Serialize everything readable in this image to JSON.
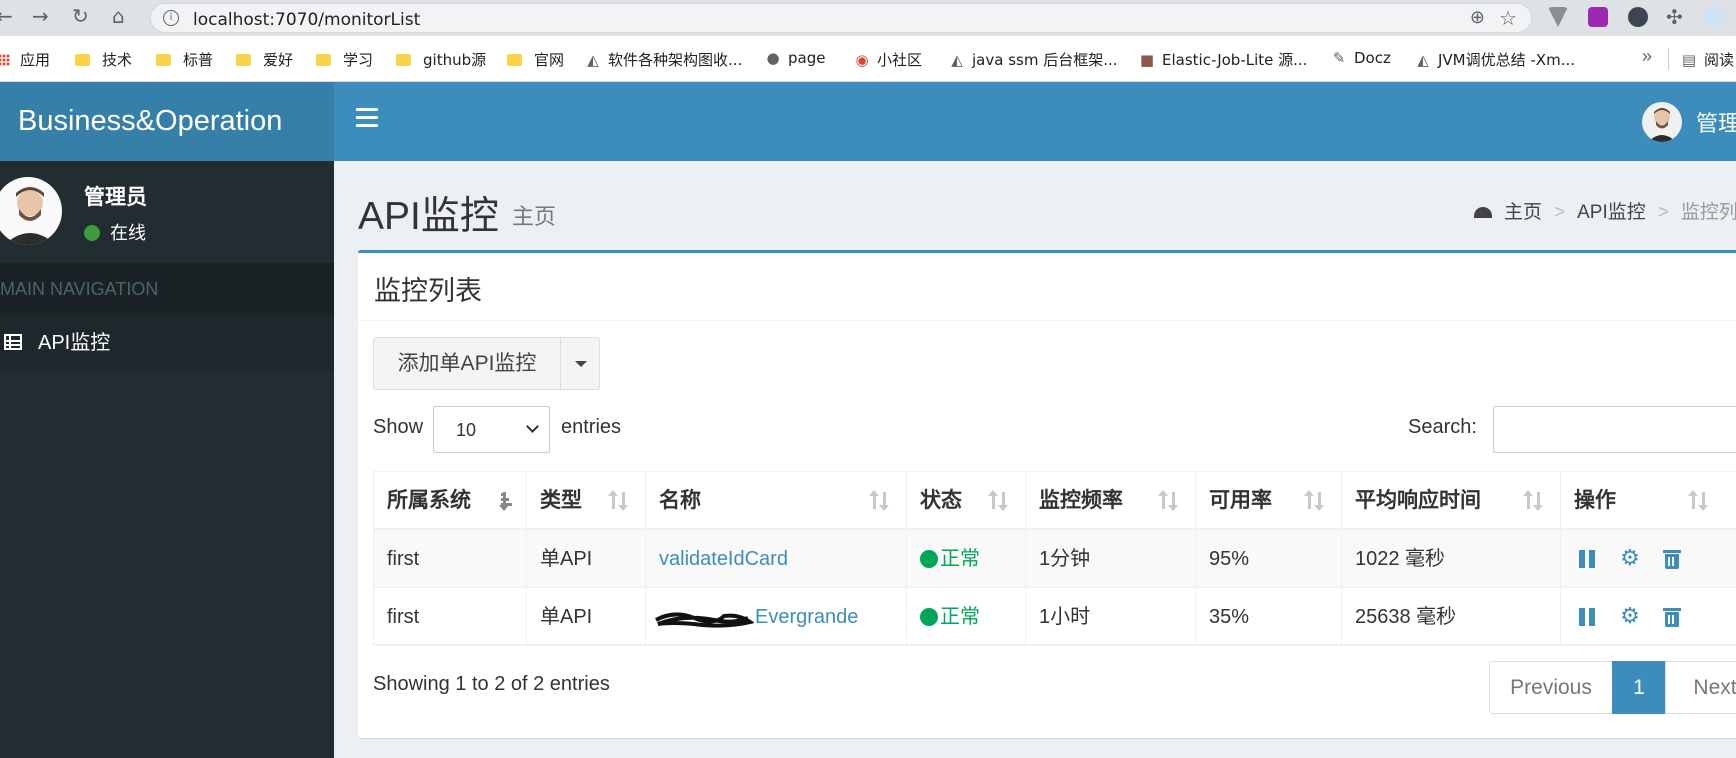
{
  "browser": {
    "url": "localhost:7070/monitorList",
    "bookmarks": [
      {
        "label": "应用",
        "icon": "apps-grid-icon"
      },
      {
        "label": "技术",
        "icon": "folder-icon"
      },
      {
        "label": "标普",
        "icon": "folder-icon"
      },
      {
        "label": "爱好",
        "icon": "folder-icon"
      },
      {
        "label": "学习",
        "icon": "folder-icon"
      },
      {
        "label": "github源",
        "icon": "folder-icon"
      },
      {
        "label": "官网",
        "icon": "folder-icon"
      },
      {
        "label": "软件各种架构图收...",
        "icon": "site-icon"
      },
      {
        "label": "page",
        "icon": "globe-icon"
      },
      {
        "label": "小社区",
        "icon": "chrome-icon"
      },
      {
        "label": "java ssm 后台框架...",
        "icon": "site-icon"
      },
      {
        "label": "Elastic-Job-Lite 源...",
        "icon": "site-icon"
      },
      {
        "label": "Docz",
        "icon": "doc-icon"
      },
      {
        "label": "JVM调优总结 -Xm...",
        "icon": "site-icon"
      }
    ],
    "bookmark_more": "»",
    "reading_list": "阅读"
  },
  "app": {
    "brand": "Business&Operation",
    "top_user": "管理",
    "sidebar": {
      "user_name": "管理员",
      "user_status": "在线",
      "header": "MAIN NAVIGATION",
      "items": [
        {
          "label": "API监控",
          "icon": "table-icon"
        }
      ]
    },
    "page": {
      "title": "API监控",
      "subtitle": "主页",
      "breadcrumb": [
        "主页",
        "API监控",
        "监控列"
      ],
      "breadcrumb_sep": ">"
    },
    "box": {
      "title": "监控列表",
      "add_button": "添加单API监控",
      "length_show": "Show",
      "length_value": "10",
      "length_entries": "entries",
      "search_label": "Search:",
      "columns": [
        "所属系统",
        "类型",
        "名称",
        "状态",
        "监控频率",
        "可用率",
        "平均响应时间",
        "操作"
      ],
      "rows": [
        {
          "system": "first",
          "type": "单API",
          "name": "validateIdCard",
          "status": "正常",
          "frequency": "1分钟",
          "availability": "95%",
          "avg_response": "1022 毫秒"
        },
        {
          "system": "first",
          "type": "单API",
          "name": "Evergrande",
          "status": "正常",
          "frequency": "1小时",
          "availability": "35%",
          "avg_response": "25638 毫秒"
        }
      ],
      "info": "Showing 1 to 2 of 2 entries",
      "pagination": {
        "previous": "Previous",
        "current": "1",
        "next": "Next"
      }
    }
  },
  "colors": {
    "topbar": "#3c8dbc",
    "logo_bar": "#367fa9",
    "sidebar": "#222d32",
    "status_ok": "#00a65a",
    "link": "#3c8dbc"
  }
}
